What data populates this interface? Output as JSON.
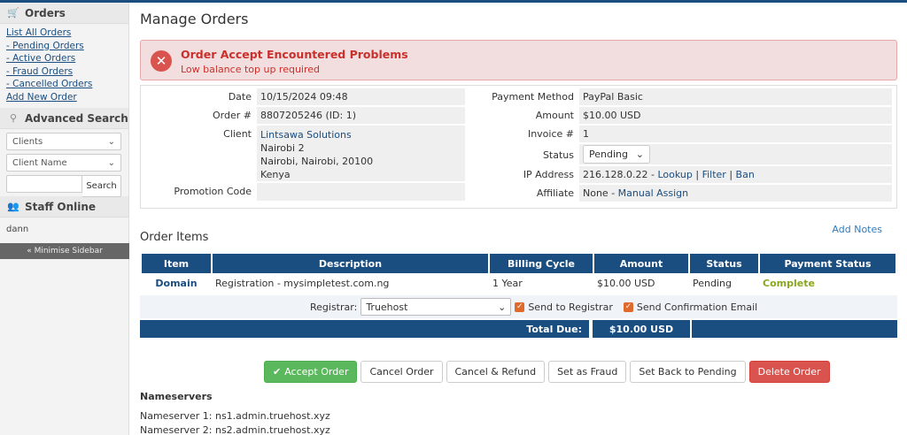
{
  "sidebar": {
    "orders_heading": "Orders",
    "order_links": [
      "List All Orders",
      "- Pending Orders",
      "- Active Orders",
      "- Fraud Orders",
      "- Cancelled Orders",
      "Add New Order"
    ],
    "advanced_search_heading": "Advanced Search",
    "search_type": "Clients",
    "search_field": "Client Name",
    "search_button": "Search",
    "staff_heading": "Staff Online",
    "staff_user": "dann",
    "minimise": "« Minimise Sidebar"
  },
  "page_title": "Manage Orders",
  "alert": {
    "title": "Order Accept Encountered Problems",
    "message": "Low balance top up required"
  },
  "order": {
    "date_label": "Date",
    "date": "10/15/2024 09:48",
    "order_no_label": "Order #",
    "order_no": "8807205246 (ID: 1)",
    "client_label": "Client",
    "client_name": "Lintsawa Solutions",
    "client_addr1": "Nairobi 2",
    "client_addr2": "Nairobi, Nairobi, 20100",
    "client_country": "Kenya",
    "promo_label": "Promotion Code",
    "promo": "",
    "payment_label": "Payment Method",
    "payment": "PayPal Basic",
    "amount_label": "Amount",
    "amount": "$10.00 USD",
    "invoice_label": "Invoice #",
    "invoice": "1",
    "status_label": "Status",
    "status": "Pending",
    "ip_label": "IP Address",
    "ip": "216.128.0.22 -",
    "ip_lookup": "Lookup",
    "ip_filter": "Filter",
    "ip_ban": "Ban",
    "sep": "|",
    "affiliate_label": "Affiliate",
    "affiliate": "None -",
    "affiliate_assign": "Manual Assign"
  },
  "items": {
    "heading": "Order Items",
    "add_notes": "Add Notes",
    "columns": [
      "Item",
      "Description",
      "Billing Cycle",
      "Amount",
      "Status",
      "Payment Status"
    ],
    "row": {
      "item": "Domain",
      "description": "Registration - mysimpletest.com.ng",
      "cycle": "1 Year",
      "amount": "$10.00 USD",
      "status": "Pending",
      "payment_status": "Complete"
    },
    "registrar_label": "Registrar:",
    "registrar": "Truehost",
    "send_to_registrar": "Send to Registrar",
    "send_email": "Send Confirmation Email",
    "total_label": "Total Due:",
    "total": "$10.00 USD"
  },
  "actions": [
    "Accept Order",
    "Cancel Order",
    "Cancel & Refund",
    "Set as Fraud",
    "Set Back to Pending",
    "Delete Order"
  ],
  "nameservers": {
    "heading": "Nameservers",
    "ns1": "Nameserver 1: ns1.admin.truehost.xyz",
    "ns2": "Nameserver 2: ns2.admin.truehost.xyz"
  },
  "colors": {
    "header_blue": "#1a4d80",
    "danger": "#d9534f",
    "success": "#5cb85c",
    "complete": "#8aa61e"
  }
}
